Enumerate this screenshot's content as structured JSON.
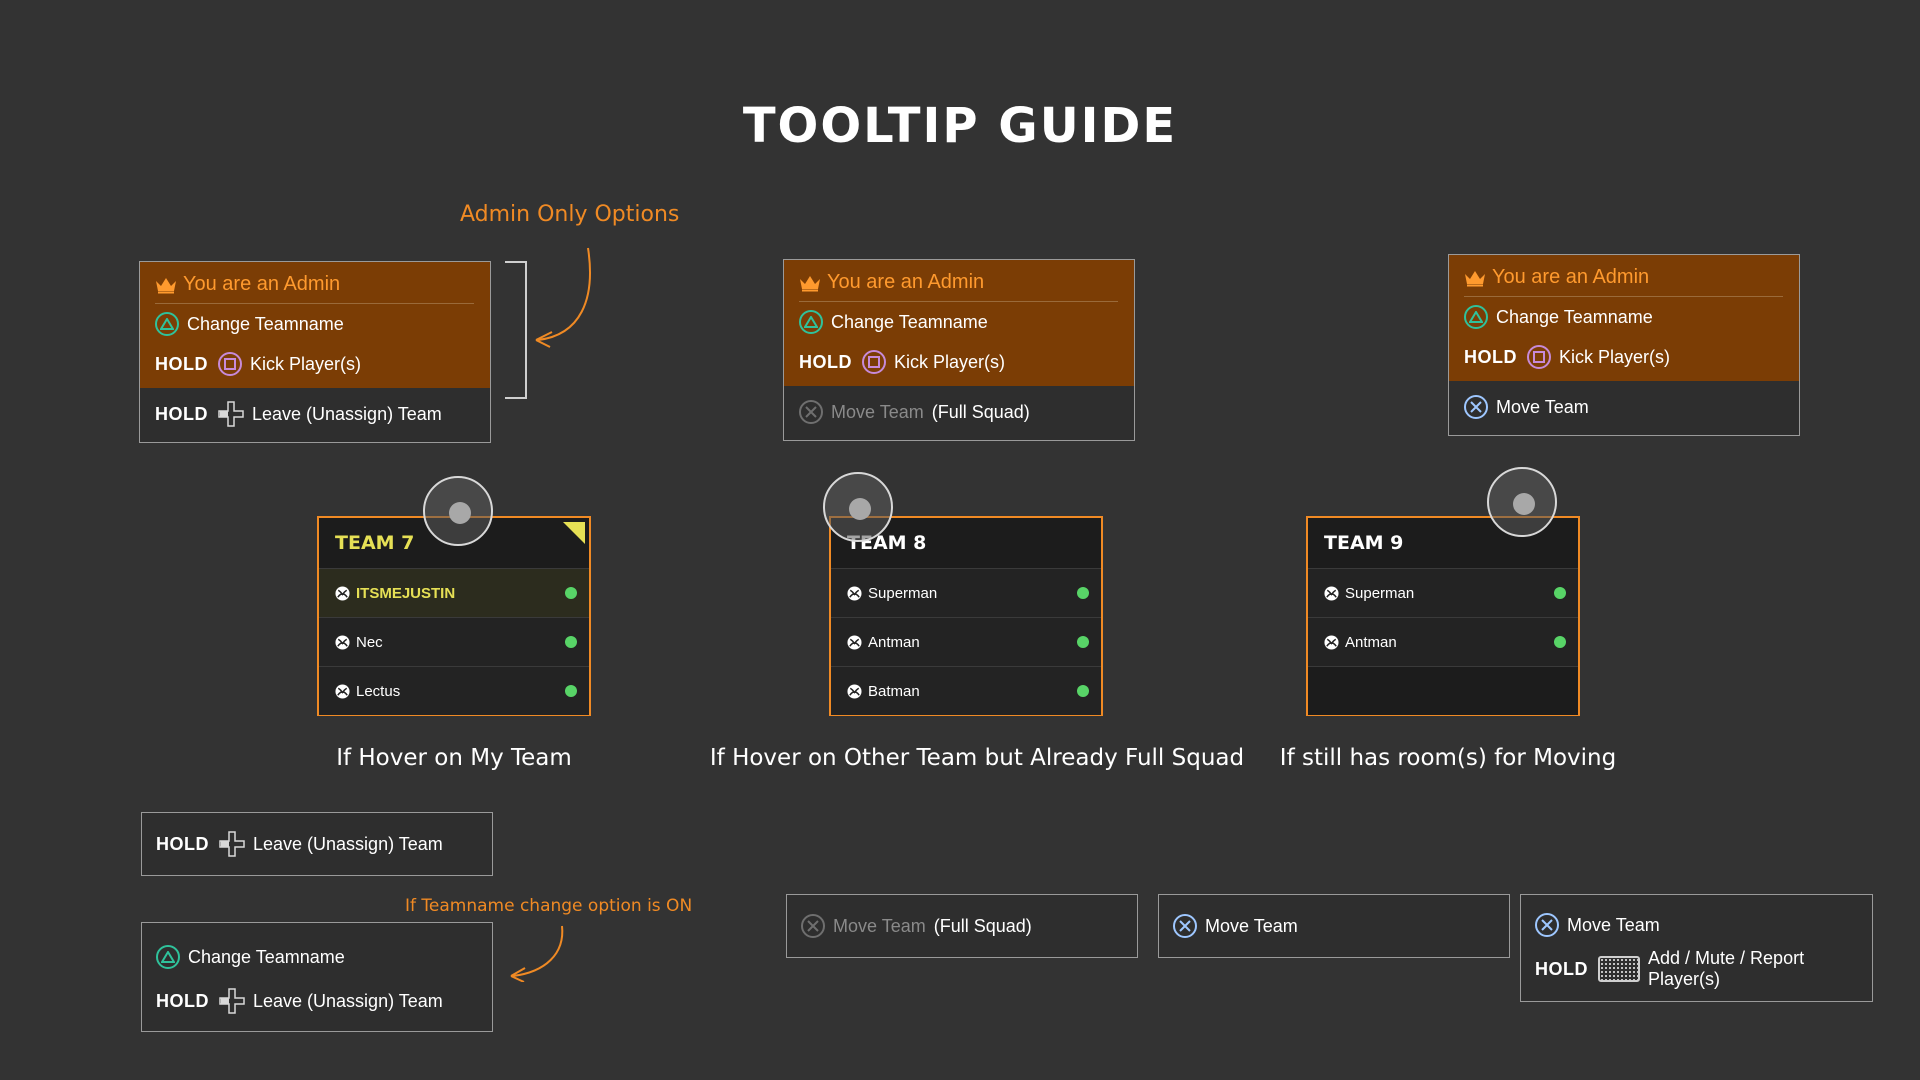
{
  "title": "TOOLTIP GUIDE",
  "admin_note": "Admin Only Options",
  "teamname_note": "If Teamname change option is ON",
  "tooltip": {
    "admin_label": "You are an Admin",
    "change_teamname": "Change Teamname",
    "hold": "HOLD",
    "kick_players": "Kick Player(s)",
    "leave_team": "Leave (Unassign) Team",
    "move_team": "Move Team",
    "full_squad": "(Full Squad)",
    "add_mute_report": "Add / Mute / Report Player(s)"
  },
  "teams": [
    {
      "name": "TEAM 7",
      "players": [
        "ITSMEJUSTIN",
        "Nec",
        "Lectus"
      ]
    },
    {
      "name": "TEAM 8",
      "players": [
        "Superman",
        "Antman",
        "Batman"
      ]
    },
    {
      "name": "TEAM 9",
      "players": [
        "Superman",
        "Antman"
      ]
    }
  ],
  "captions": {
    "my_team": "If Hover on My Team",
    "full_squad": "If Hover on Other Team but Already Full Squad",
    "has_room": "If still has room(s) for Moving"
  },
  "colors": {
    "accent": "#f08a24",
    "admin_bg": "#7b3d05",
    "online": "#58d467",
    "highlight": "#e6e055"
  }
}
